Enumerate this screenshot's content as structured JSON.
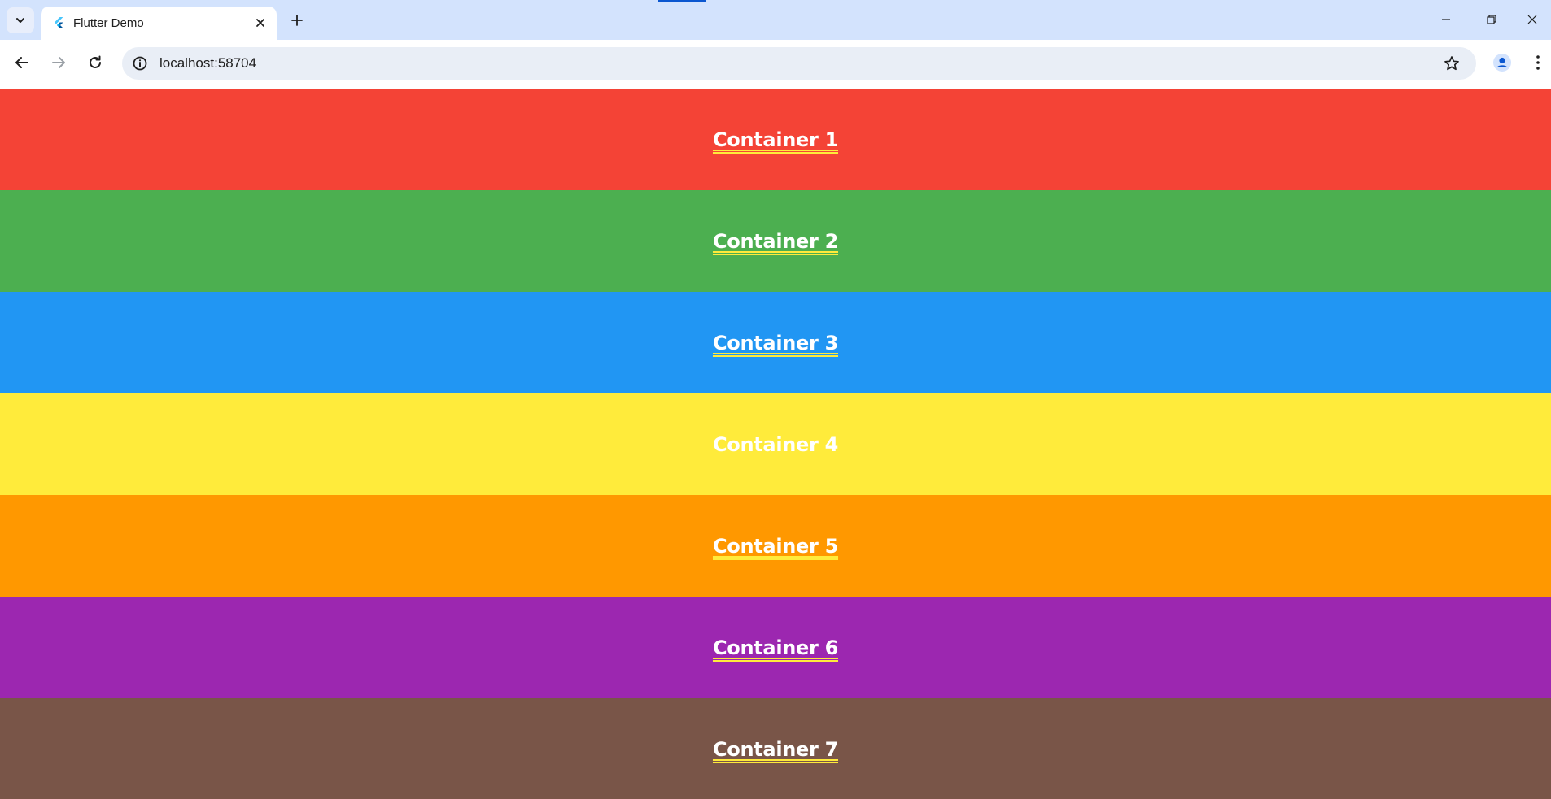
{
  "browser": {
    "tab_title": "Flutter Demo",
    "url": "localhost:58704"
  },
  "icons": {
    "tab_search": "chevron-down-icon",
    "favicon": "flutter-logo-icon",
    "tab_close": "close-icon",
    "new_tab": "plus-icon",
    "minimize": "minimize-icon",
    "restore": "restore-icon",
    "window_close": "close-icon",
    "back": "arrow-left-icon",
    "forward": "arrow-right-icon",
    "reload": "reload-icon",
    "site_info": "info-icon",
    "bookmark": "star-icon",
    "profile": "person-icon",
    "menu": "kebab-menu-icon"
  },
  "containers": [
    {
      "label": "Container 1",
      "color": "#f44336"
    },
    {
      "label": "Container 2",
      "color": "#4caf50"
    },
    {
      "label": "Container 3",
      "color": "#2196f3"
    },
    {
      "label": "Container 4",
      "color": "#ffeb3b"
    },
    {
      "label": "Container 5",
      "color": "#ff9800"
    },
    {
      "label": "Container 6",
      "color": "#9c27b0"
    },
    {
      "label": "Container 7",
      "color": "#795548"
    }
  ]
}
